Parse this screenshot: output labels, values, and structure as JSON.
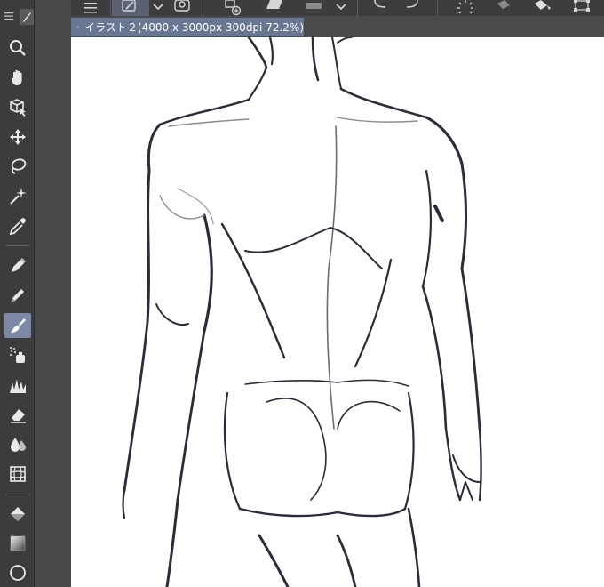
{
  "document": {
    "tab_title": "イラスト２(4000 x 3000px 300dpi 72.2%)"
  },
  "colors": {
    "toolbar_bg": "#3c3c3c",
    "active_tool": "#7c88a6",
    "tab_bg": "#6a7793",
    "canvas_bg": "#ffffff",
    "sketch_stroke": "#2b2b3a"
  },
  "toolbar": {
    "tools": [
      {
        "icon": "zoom-icon"
      },
      {
        "icon": "hand-icon"
      },
      {
        "icon": "object-select-icon"
      },
      {
        "icon": "move-icon"
      },
      {
        "icon": "lasso-icon"
      },
      {
        "icon": "magic-wand-icon"
      },
      {
        "icon": "eyedropper-icon"
      },
      {
        "icon": "pen-icon"
      },
      {
        "icon": "pencil-icon"
      },
      {
        "icon": "brush-icon",
        "active": true
      },
      {
        "icon": "airbrush-icon"
      },
      {
        "icon": "decoration-icon"
      },
      {
        "icon": "eraser-icon"
      },
      {
        "icon": "blend-icon"
      },
      {
        "icon": "figure-icon"
      },
      {
        "icon": "fill-icon"
      },
      {
        "icon": "gradient-icon"
      },
      {
        "icon": "shape-icon"
      }
    ]
  },
  "topbar": {
    "icons": [
      "menu-icon",
      "edit-icon",
      "chevron-down-icon",
      "stamp-icon",
      "add-icon",
      "layer-icon",
      "print-icon",
      "chevron-down-icon",
      "undo-icon",
      "redo-icon",
      "loading-icon",
      "fill-bucket-icon",
      "transform-icon"
    ]
  }
}
